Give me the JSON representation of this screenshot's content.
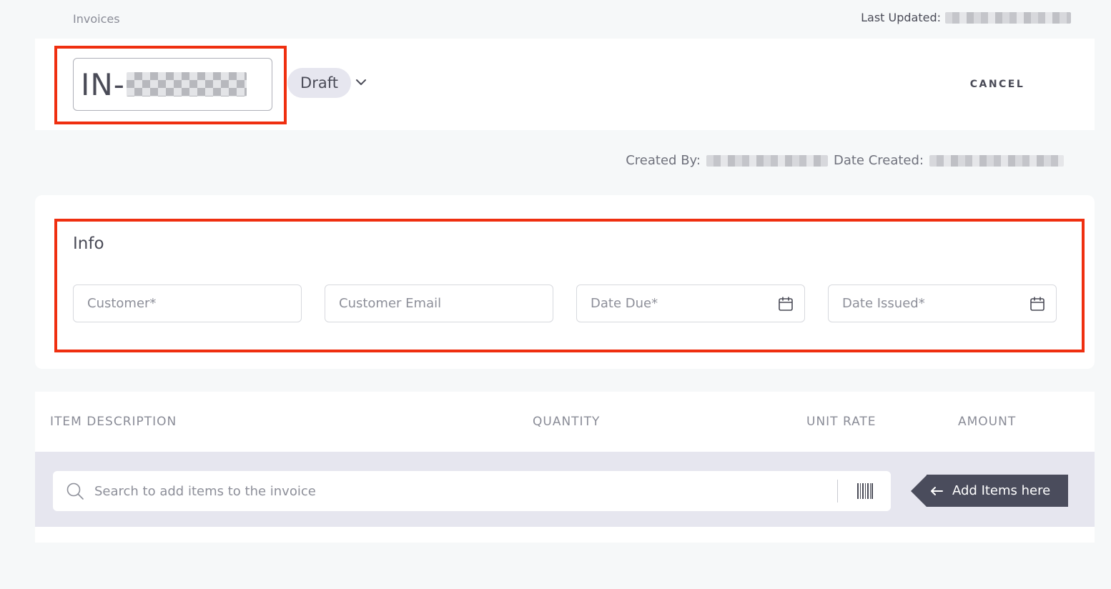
{
  "breadcrumb": {
    "label": "Invoices"
  },
  "header": {
    "last_updated_label": "Last Updated:",
    "invoice_prefix": "IN-",
    "status": "Draft",
    "cancel_label": "CANCEL"
  },
  "meta": {
    "created_by_label": "Created By:",
    "date_created_label": "Date Created:"
  },
  "info": {
    "title": "Info",
    "customer_placeholder": "Customer*",
    "customer_email_placeholder": "Customer Email",
    "date_due_placeholder": "Date Due*",
    "date_issued_placeholder": "Date Issued*"
  },
  "items": {
    "columns": [
      "ITEM DESCRIPTION",
      "QUANTITY",
      "UNIT RATE",
      "AMOUNT"
    ],
    "search_placeholder": "Search to add items to the invoice",
    "add_items_hint": "Add Items here"
  },
  "colors": {
    "highlight": "#ef2f10",
    "callout": "#4a4c5c",
    "band": "#e6e6ef"
  }
}
